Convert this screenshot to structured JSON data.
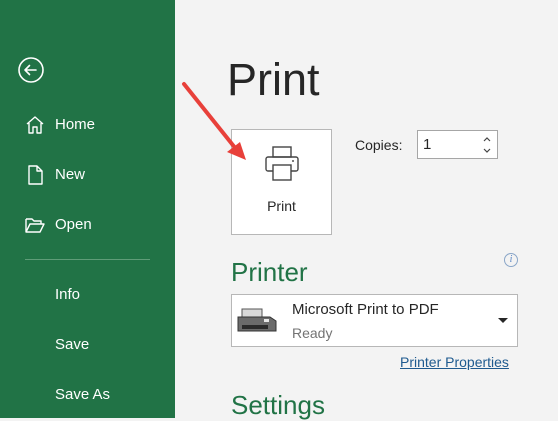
{
  "sidebar": {
    "back_icon": "back-arrow-circle-icon",
    "items": [
      {
        "label": "Home",
        "icon": "home-icon"
      },
      {
        "label": "New",
        "icon": "new-document-icon"
      },
      {
        "label": "Open",
        "icon": "open-folder-icon"
      },
      {
        "label": "Info"
      },
      {
        "label": "Save"
      },
      {
        "label": "Save As"
      }
    ],
    "background_color": "#217346"
  },
  "main": {
    "title": "Print",
    "print_button": {
      "label": "Print",
      "icon": "printer-icon"
    },
    "copies": {
      "label": "Copies:",
      "value": "1"
    },
    "printer_section": {
      "title": "Printer",
      "selected_printer": "Microsoft Print to PDF",
      "status": "Ready",
      "properties_link": "Printer Properties"
    },
    "settings_section": {
      "title": "Settings"
    },
    "accent_color": "#217346",
    "annotation": {
      "icon": "red-arrow-icon",
      "color": "#e8403a"
    }
  }
}
